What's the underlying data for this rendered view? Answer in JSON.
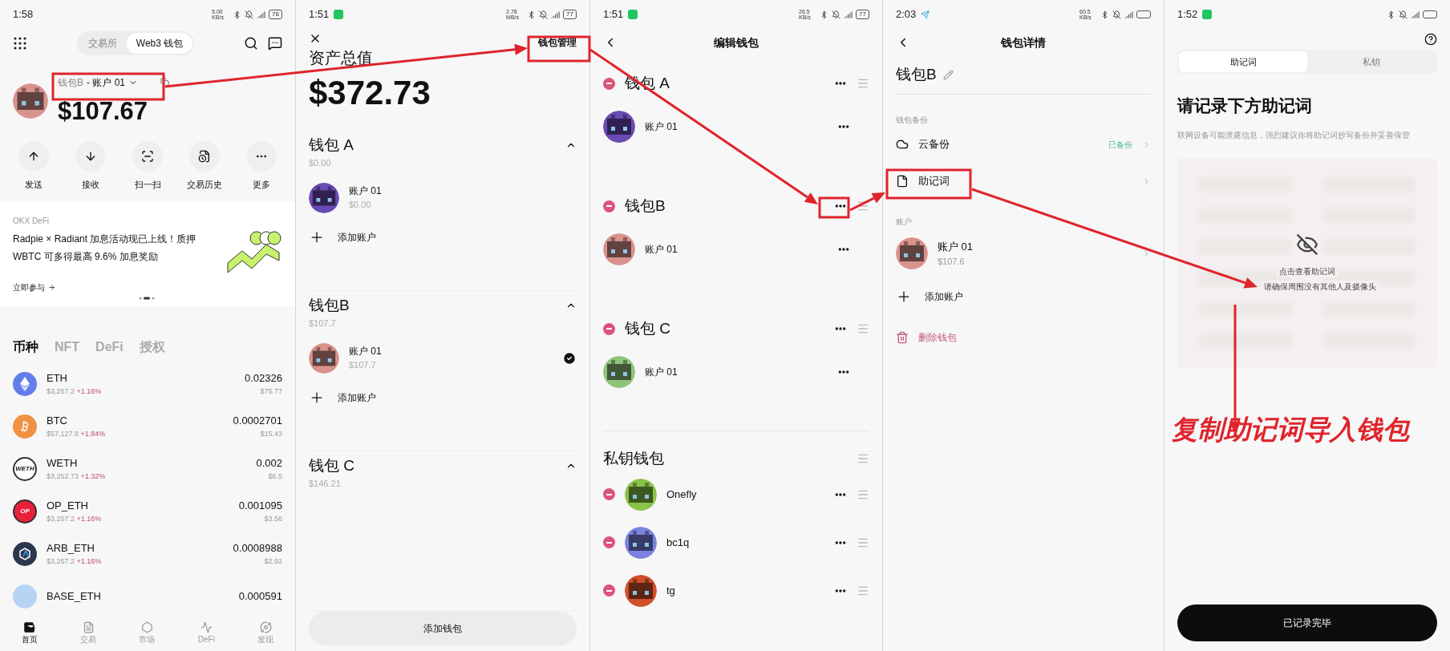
{
  "home": {
    "status": {
      "time": "1:58",
      "speed": "5.00 KB/s",
      "battery": "76"
    },
    "tabs": [
      {
        "label": "交易所",
        "selected": false
      },
      {
        "label": "Web3 钱包",
        "selected": true
      }
    ],
    "wallet_name": "钱包B",
    "account_name": "- 账户 01",
    "avatar": {
      "color": "#d8938c"
    },
    "balance": "$107.67",
    "actions": [
      {
        "kind": "send",
        "label": "发送"
      },
      {
        "kind": "receive",
        "label": "接收"
      },
      {
        "kind": "scan",
        "label": "扫一扫"
      },
      {
        "kind": "history",
        "label": "交易历史"
      },
      {
        "kind": "more",
        "label": "更多"
      }
    ],
    "banner": {
      "source": "OKX DeFi",
      "text": "Radpie × Radiant 加息活动现已上线！质押 WBTC 可多得最高 9.6% 加息奖励",
      "link": "立即参与"
    },
    "asset_tabs": [
      {
        "label": "币种",
        "selected": true
      },
      {
        "label": "NFT",
        "selected": false
      },
      {
        "label": "DeFi",
        "selected": false
      },
      {
        "label": "授权",
        "selected": false
      }
    ],
    "tokens": [
      {
        "kind": "eth",
        "color": "#627eea",
        "symbol": "ETH",
        "price": "$3,257.2",
        "change": "+1.16%",
        "amount": "0.02326",
        "value": "$75.77"
      },
      {
        "kind": "btc",
        "color": "#f09242",
        "symbol": "BTC",
        "price": "$57,127.8",
        "change": "+1.84%",
        "amount": "0.0002701",
        "value": "$15.43"
      },
      {
        "kind": "text",
        "color": "#ffffff",
        "logo_text": "WETH",
        "symbol": "WETH",
        "price": "$3,252.73",
        "change": "+1.32%",
        "amount": "0.002",
        "value": "$6.5"
      },
      {
        "kind": "text",
        "color": "#e8203a",
        "logo_text": "OP",
        "symbol": "OP_ETH",
        "price": "$3,257.2",
        "change": "+1.16%",
        "amount": "0.001095",
        "value": "$3.56"
      },
      {
        "kind": "arb",
        "color": "#2d374b",
        "symbol": "ARB_ETH",
        "price": "$3,257.2",
        "change": "+1.16%",
        "amount": "0.0008988",
        "value": "$2.92"
      },
      {
        "kind": "plain",
        "color": "#b8d4f4",
        "symbol": "BASE_ETH",
        "amount": "0.000591"
      }
    ],
    "nav": [
      {
        "kind": "home",
        "label": "首页",
        "selected": true
      },
      {
        "kind": "trade",
        "label": "交易",
        "selected": false
      },
      {
        "kind": "market",
        "label": "市场",
        "selected": false
      },
      {
        "kind": "defi",
        "label": "DeFi",
        "selected": false
      },
      {
        "kind": "discover",
        "label": "发现",
        "selected": false
      }
    ]
  },
  "assets": {
    "status": {
      "time": "1:51",
      "speed": "2.78 MB/s",
      "battery": "77"
    },
    "title": "资产总值",
    "manage": "钱包管理",
    "total": "$372.73",
    "wallets": [
      {
        "name": "钱包 A",
        "amount": "$0.00",
        "expanded": true,
        "accounts": [
          {
            "name": "账户 01",
            "amount": "$0.00",
            "color": "#6a4bb5",
            "selected": false
          }
        ],
        "add": "添加账户"
      },
      {
        "name": "钱包B",
        "amount": "$107.7",
        "expanded": true,
        "accounts": [
          {
            "name": "账户 01",
            "amount": "$107.7",
            "color": "#d8938c",
            "selected": true
          }
        ],
        "add": "添加账户"
      },
      {
        "name": "钱包 C",
        "amount": "$146.21",
        "expanded": true
      }
    ],
    "add_wallet": "添加钱包"
  },
  "edit": {
    "status": {
      "time": "1:51",
      "speed": "26.5 KB/s",
      "battery": "77"
    },
    "title": "编辑钱包",
    "wallets": [
      {
        "name": "钱包 A",
        "accounts": [
          {
            "name": "账户 01",
            "color": "#6a4bb5"
          }
        ]
      },
      {
        "name": "钱包B",
        "accounts": [
          {
            "name": "账户 01",
            "color": "#d8938c"
          }
        ]
      },
      {
        "name": "钱包 C",
        "accounts": [
          {
            "name": "账户 01",
            "color": "#8fc47a"
          }
        ]
      }
    ],
    "private_title": "私钥钱包",
    "private_wallets": [
      {
        "name": "Onefly",
        "color": "#8bc34a"
      },
      {
        "name": "bc1q",
        "color": "#7b83e0"
      },
      {
        "name": "tg",
        "color": "#d0502a"
      }
    ]
  },
  "detail": {
    "status": {
      "time": "2:03",
      "speed": "60.5 KB/s"
    },
    "title": "钱包详情",
    "name": "钱包B",
    "backup_section": "钱包备份",
    "backup_items": [
      {
        "kind": "cloud",
        "label": "云备份",
        "status": "已备份"
      },
      {
        "kind": "mnemonic",
        "label": "助记词"
      }
    ],
    "accounts_section": "账户",
    "accounts": [
      {
        "name": "账户 01",
        "amount": "$107.6",
        "color": "#d8938c"
      }
    ],
    "add": "添加账户",
    "delete": "删除钱包"
  },
  "mnemonic": {
    "status": {
      "time": "1:52"
    },
    "tabs": [
      {
        "label": "助记词",
        "selected": true
      },
      {
        "label": "私钥",
        "selected": false
      }
    ],
    "heading": "请记录下方助记词",
    "warning": "联网设备可能泄露信息，强烈建议你将助记词抄写备份并妥善保管",
    "reveal": "点击查看助记词",
    "reveal_hint": "请确保周围没有其他人及摄像头",
    "caption": "复制助记词导入钱包",
    "done": "已记录完毕"
  }
}
